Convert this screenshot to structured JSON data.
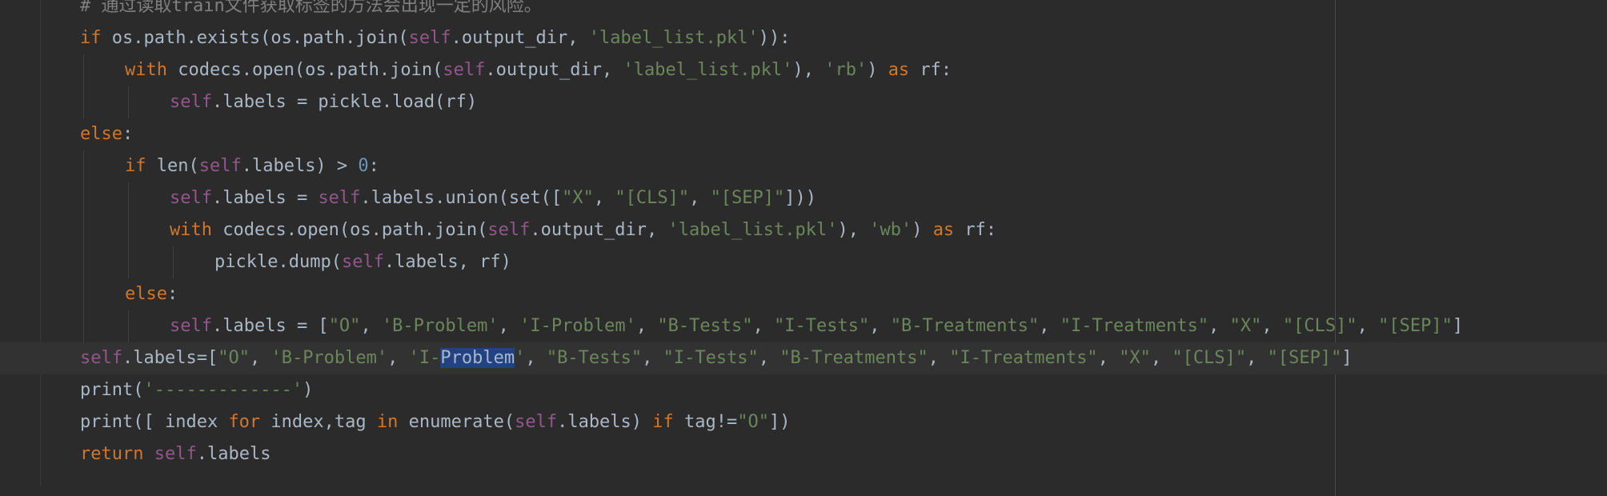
{
  "colors": {
    "background": "#2b2b2b",
    "current_line": "#323232",
    "default_text": "#a9b7c6",
    "keyword": "#cc7832",
    "self": "#94558d",
    "string": "#6a8759",
    "number": "#6897bb",
    "comment": "#808080",
    "selection": "#214283"
  },
  "editor": {
    "current_line_index": 11,
    "lines": [
      {
        "indent": 0,
        "tokens": [
          [
            "cmt",
            "# 通过读取train文件获取标签的方法会出现一定的风险。"
          ]
        ]
      },
      {
        "indent": 0,
        "tokens": [
          [
            "kw",
            "if"
          ],
          [
            "op",
            " os.path.exists(os.path.join("
          ],
          [
            "self",
            "self"
          ],
          [
            "op",
            ".output_dir, "
          ],
          [
            "str",
            "'label_list.pkl'"
          ],
          [
            "op",
            ")):"
          ]
        ]
      },
      {
        "indent": 1,
        "tokens": [
          [
            "kw",
            "with"
          ],
          [
            "op",
            " codecs.open(os.path.join("
          ],
          [
            "self",
            "self"
          ],
          [
            "op",
            ".output_dir, "
          ],
          [
            "str",
            "'label_list.pkl'"
          ],
          [
            "op",
            "), "
          ],
          [
            "str",
            "'rb'"
          ],
          [
            "op",
            ") "
          ],
          [
            "kw",
            "as"
          ],
          [
            "op",
            " rf:"
          ]
        ]
      },
      {
        "indent": 2,
        "tokens": [
          [
            "self",
            "self"
          ],
          [
            "op",
            ".labels = pickle.load(rf)"
          ]
        ]
      },
      {
        "indent": 0,
        "tokens": [
          [
            "kw",
            "else"
          ],
          [
            "op",
            ":"
          ]
        ]
      },
      {
        "indent": 1,
        "tokens": [
          [
            "kw",
            "if"
          ],
          [
            "op",
            " len("
          ],
          [
            "self",
            "self"
          ],
          [
            "op",
            ".labels) > "
          ],
          [
            "num",
            "0"
          ],
          [
            "op",
            ":"
          ]
        ]
      },
      {
        "indent": 2,
        "tokens": [
          [
            "self",
            "self"
          ],
          [
            "op",
            ".labels = "
          ],
          [
            "self",
            "self"
          ],
          [
            "op",
            ".labels.union(set(["
          ],
          [
            "str",
            "\"X\""
          ],
          [
            "op",
            ", "
          ],
          [
            "str",
            "\"[CLS]\""
          ],
          [
            "op",
            ", "
          ],
          [
            "str",
            "\"[SEP]\""
          ],
          [
            "op",
            "]))"
          ]
        ]
      },
      {
        "indent": 2,
        "tokens": [
          [
            "kw",
            "with"
          ],
          [
            "op",
            " codecs.open(os.path.join("
          ],
          [
            "self",
            "self"
          ],
          [
            "op",
            ".output_dir, "
          ],
          [
            "str",
            "'label_list.pkl'"
          ],
          [
            "op",
            "), "
          ],
          [
            "str",
            "'wb'"
          ],
          [
            "op",
            ") "
          ],
          [
            "kw",
            "as"
          ],
          [
            "op",
            " rf:"
          ]
        ]
      },
      {
        "indent": 3,
        "tokens": [
          [
            "op",
            "pickle.dump("
          ],
          [
            "self",
            "self"
          ],
          [
            "op",
            ".labels, rf)"
          ]
        ]
      },
      {
        "indent": 1,
        "tokens": [
          [
            "kw",
            "else"
          ],
          [
            "op",
            ":"
          ]
        ]
      },
      {
        "indent": 2,
        "tokens": [
          [
            "self",
            "self"
          ],
          [
            "op",
            ".labels = ["
          ],
          [
            "str",
            "\"O\""
          ],
          [
            "op",
            ", "
          ],
          [
            "str",
            "'B-Problem'"
          ],
          [
            "op",
            ", "
          ],
          [
            "str",
            "'I-Problem'"
          ],
          [
            "op",
            ", "
          ],
          [
            "str",
            "\"B-Tests\""
          ],
          [
            "op",
            ", "
          ],
          [
            "str",
            "\"I-Tests\""
          ],
          [
            "op",
            ", "
          ],
          [
            "str",
            "\"B-Treatments\""
          ],
          [
            "op",
            ", "
          ],
          [
            "str",
            "\"I-Treatments\""
          ],
          [
            "op",
            ", "
          ],
          [
            "str",
            "\"X\""
          ],
          [
            "op",
            ", "
          ],
          [
            "str",
            "\"[CLS]\""
          ],
          [
            "op",
            ", "
          ],
          [
            "str",
            "\"[SEP]\""
          ],
          [
            "op",
            "]"
          ]
        ]
      },
      {
        "indent": 0,
        "tokens": [
          [
            "self",
            "self"
          ],
          [
            "op",
            ".labels=["
          ],
          [
            "str",
            "\"O\""
          ],
          [
            "op",
            ", "
          ],
          [
            "str",
            "'B-Problem'"
          ],
          [
            "op",
            ", "
          ],
          [
            "str",
            "'I-"
          ],
          [
            "sel",
            "Problem"
          ],
          [
            "str",
            "'"
          ],
          [
            "op",
            ", "
          ],
          [
            "str",
            "\"B-Tests\""
          ],
          [
            "op",
            ", "
          ],
          [
            "str",
            "\"I-Tests\""
          ],
          [
            "op",
            ", "
          ],
          [
            "str",
            "\"B-Treatments\""
          ],
          [
            "op",
            ", "
          ],
          [
            "str",
            "\"I-Treatments\""
          ],
          [
            "op",
            ", "
          ],
          [
            "str",
            "\"X\""
          ],
          [
            "op",
            ", "
          ],
          [
            "str",
            "\"[CLS]\""
          ],
          [
            "op",
            ", "
          ],
          [
            "str",
            "\"[SEP]\""
          ],
          [
            "op",
            "]"
          ]
        ]
      },
      {
        "indent": 0,
        "tokens": [
          [
            "op",
            "print("
          ],
          [
            "str",
            "'-------------'"
          ],
          [
            "op",
            ")"
          ]
        ]
      },
      {
        "indent": 0,
        "tokens": [
          [
            "op",
            "print([ index "
          ],
          [
            "kw",
            "for"
          ],
          [
            "op",
            " index,tag "
          ],
          [
            "kw",
            "in"
          ],
          [
            "op",
            " enumerate("
          ],
          [
            "self",
            "self"
          ],
          [
            "op",
            ".labels) "
          ],
          [
            "kw",
            "if"
          ],
          [
            "op",
            " tag!="
          ],
          [
            "str",
            "\"O\""
          ],
          [
            "op",
            "])"
          ]
        ]
      },
      {
        "indent": 0,
        "tokens": [
          [
            "kw",
            "return"
          ],
          [
            "op",
            " "
          ],
          [
            "self",
            "self"
          ],
          [
            "op",
            ".labels"
          ]
        ]
      }
    ]
  }
}
